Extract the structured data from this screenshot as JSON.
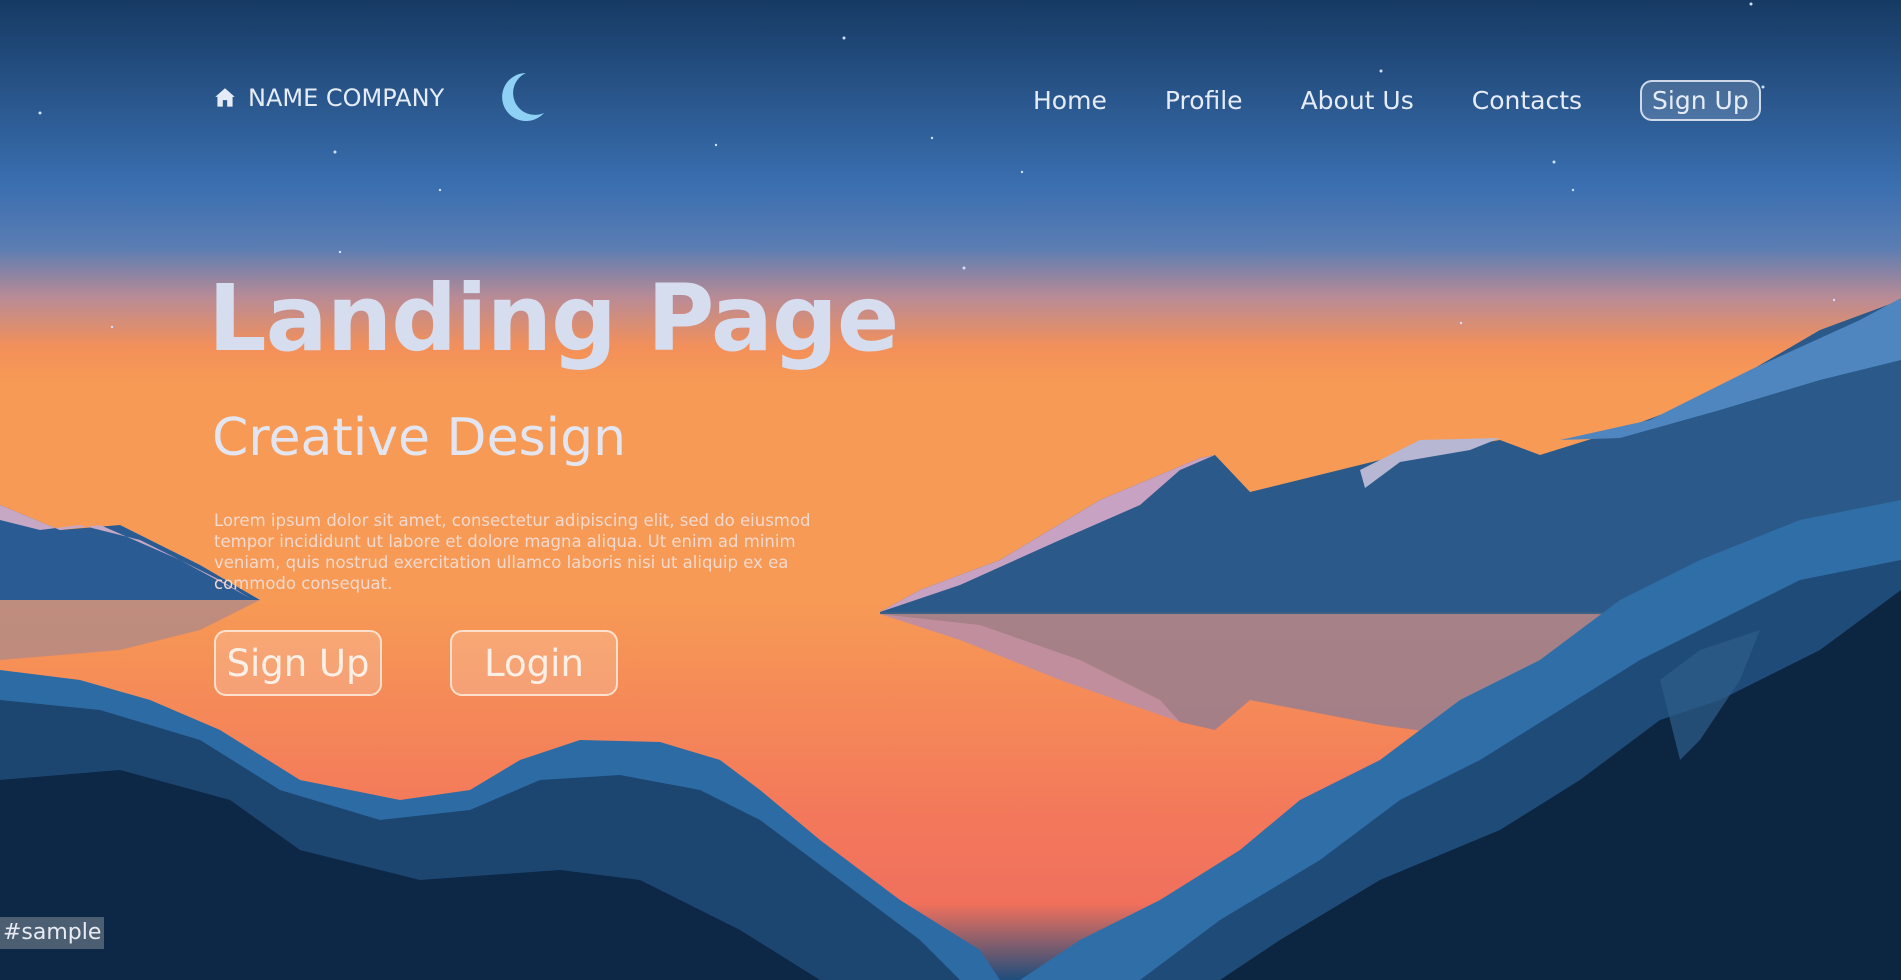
{
  "brand": {
    "name": "NAME COMPANY",
    "icon": "home-icon"
  },
  "decor": {
    "moon_icon": "crescent-moon-icon"
  },
  "nav": {
    "items": [
      "Home",
      "Profile",
      "About Us",
      "Contacts"
    ],
    "signup_label": "Sign Up"
  },
  "hero": {
    "title": "Landing Page",
    "subtitle": "Creative Design",
    "body": "Lorem ipsum dolor sit amet, consectetur adipiscing elit, sed do eiusmod tempor incididunt ut labore et dolore magna aliqua. Ut enim ad minim veniam, quis nostrud exercitation ullamco laboris nisi ut aliquip ex ea commodo consequat.",
    "signup_label": "Sign Up",
    "login_label": "Login"
  },
  "watermark": "#sample",
  "colors": {
    "sky_top": "#163a63",
    "sky_mid": "#3f78c0",
    "sunset": "#f59a5c",
    "lake": "#f5875e",
    "mountain_dark": "#0b2340",
    "mountain_mid": "#24527e",
    "snow": "#c9a9c4"
  }
}
